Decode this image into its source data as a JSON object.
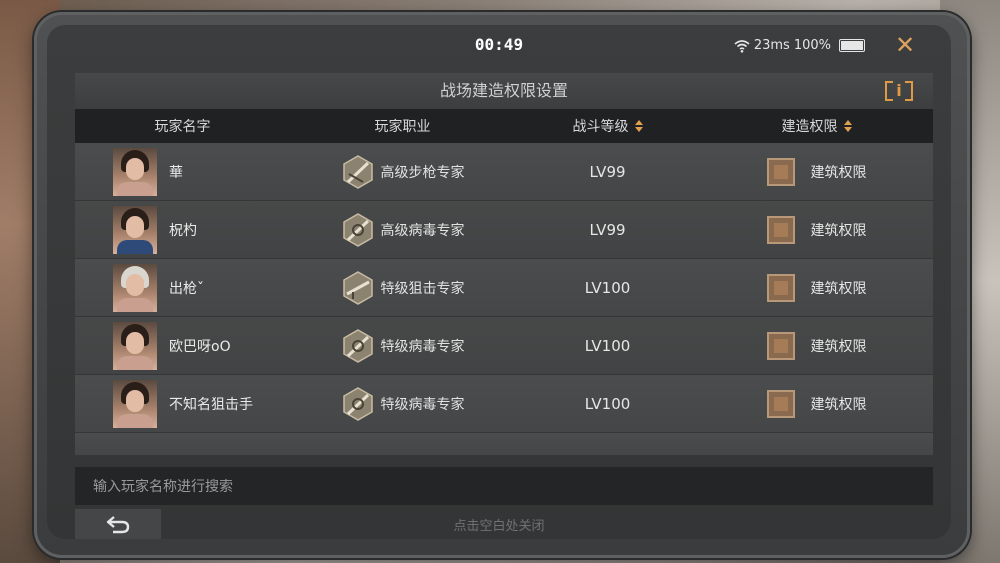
{
  "status_bar": {
    "timer": "00:49",
    "ping": "23ms",
    "battery": "100%",
    "close_icon": "close-icon",
    "close_color": "#e0a15e"
  },
  "panel": {
    "title": "战场建造权限设置",
    "info_label": "i",
    "info_color": "#e09a45"
  },
  "table": {
    "columns": [
      {
        "label": "玩家名字",
        "sortable": false
      },
      {
        "label": "玩家职业",
        "sortable": false
      },
      {
        "label": "战斗等级",
        "sortable": true
      },
      {
        "label": "建造权限",
        "sortable": true
      }
    ],
    "rows": [
      {
        "name": "華",
        "profession": "高级步枪专家",
        "level": "LV99",
        "permission": "建筑权限",
        "avatar": "female-dark-hair"
      },
      {
        "name": "柷杓",
        "profession": "高级病毒专家",
        "level": "LV99",
        "permission": "建筑权限",
        "avatar": "male-brown-hair"
      },
      {
        "name": "出枪ˇ",
        "profession": "特级狙击专家",
        "level": "LV100",
        "permission": "建筑权限",
        "avatar": "female-silver-hair"
      },
      {
        "name": "欧巴呀oO",
        "profession": "特级病毒专家",
        "level": "LV100",
        "permission": "建筑权限",
        "avatar": "female-dark-hair"
      },
      {
        "name": "不知名狙击手",
        "profession": "特级病毒专家",
        "level": "LV100",
        "permission": "建筑权限",
        "avatar": "female-dark-hair"
      }
    ]
  },
  "search": {
    "placeholder": "输入玩家名称进行搜索"
  },
  "footer": {
    "back_icon": "back-arrow-icon",
    "hint": "点击空白处关闭"
  },
  "colors": {
    "accent": "#e0a050",
    "checkbox": "#8a6a4e"
  }
}
